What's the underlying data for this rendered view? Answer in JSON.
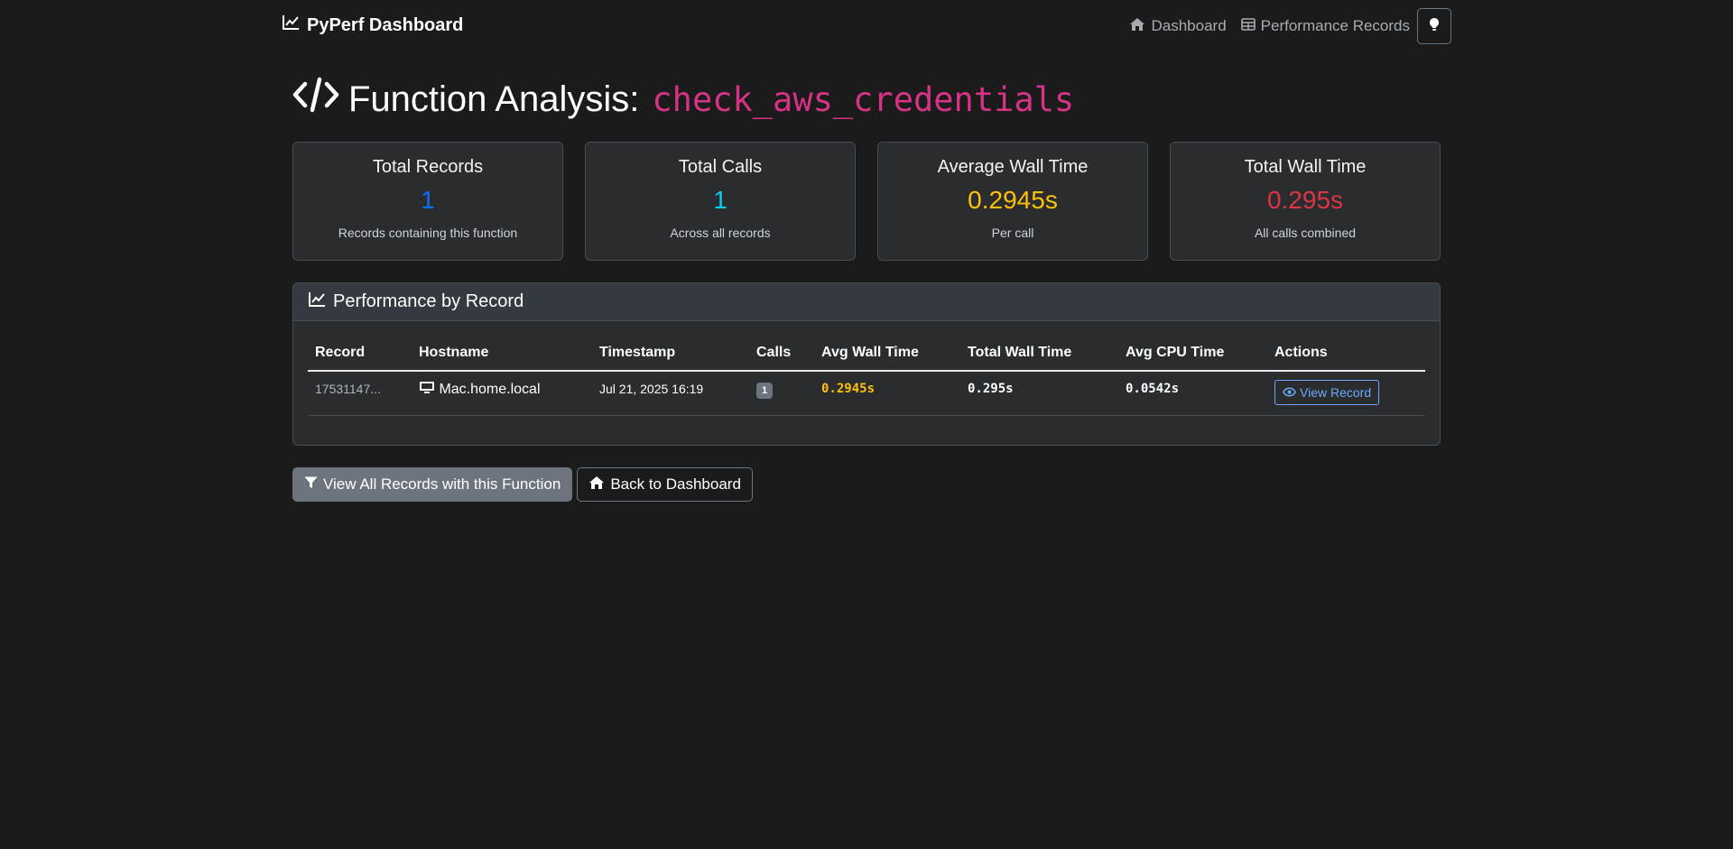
{
  "navbar": {
    "brand": "PyPerf Dashboard",
    "links": [
      {
        "label": "Dashboard",
        "icon": "home-icon"
      },
      {
        "label": "Performance Records",
        "icon": "table-icon"
      }
    ],
    "theme_icon": "lightbulb-icon"
  },
  "page": {
    "title_prefix": "Function Analysis:",
    "function_name": "check_aws_credentials"
  },
  "stats": [
    {
      "title": "Total Records",
      "value": "1",
      "sub": "Records containing this function",
      "color": "#0d6efd"
    },
    {
      "title": "Total Calls",
      "value": "1",
      "sub": "Across all records",
      "color": "#0dcaf0"
    },
    {
      "title": "Average Wall Time",
      "value": "0.2945s",
      "sub": "Per call",
      "color": "#ffc107"
    },
    {
      "title": "Total Wall Time",
      "value": "0.295s",
      "sub": "All calls combined",
      "color": "#dc3545"
    }
  ],
  "panel": {
    "title": "Performance by Record",
    "columns": [
      "Record",
      "Hostname",
      "Timestamp",
      "Calls",
      "Avg Wall Time",
      "Total Wall Time",
      "Avg CPU Time",
      "Actions"
    ],
    "rows": [
      {
        "record": "17531147...",
        "hostname": "Mac.home.local",
        "timestamp": "Jul 21, 2025 16:19",
        "calls": "1",
        "avg_wall": "0.2945s",
        "total_wall": "0.295s",
        "avg_cpu": "0.0542s",
        "action_label": "View Record"
      }
    ]
  },
  "actions": {
    "view_all_label": "View All Records with this Function",
    "back_label": "Back to Dashboard"
  }
}
